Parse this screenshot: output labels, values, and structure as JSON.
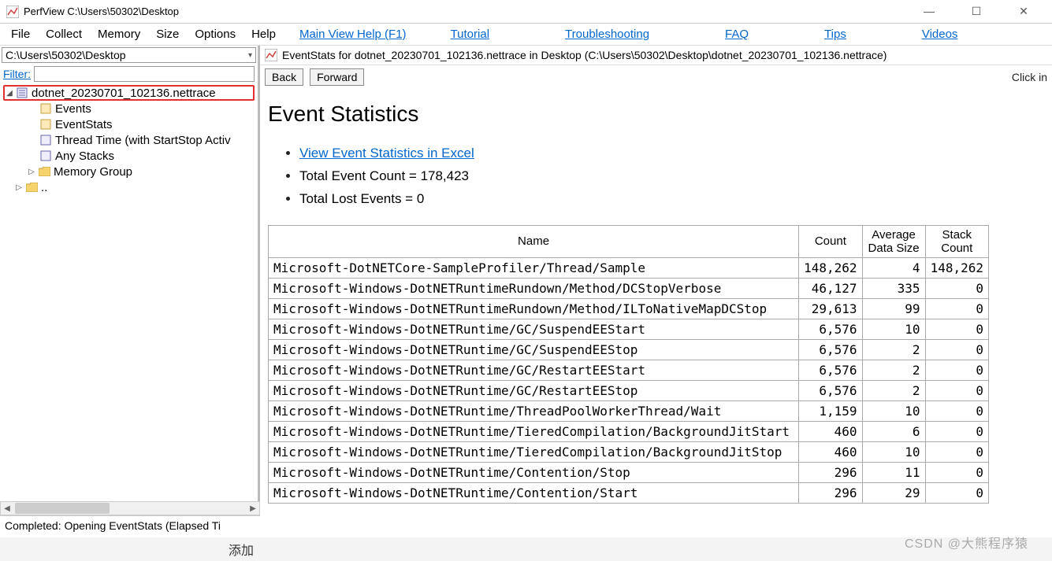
{
  "window": {
    "title": "PerfView C:\\Users\\50302\\Desktop",
    "min": "—",
    "max": "☐",
    "close": "✕"
  },
  "menu": {
    "file": "File",
    "collect": "Collect",
    "memory": "Memory",
    "size": "Size",
    "options": "Options",
    "help": "Help",
    "main_help": "Main View Help (F1)",
    "tutorial": "Tutorial",
    "troubleshooting": "Troubleshooting",
    "faq": "FAQ",
    "tips": "Tips",
    "videos": "Videos"
  },
  "left": {
    "path": "C:\\Users\\50302\\Desktop",
    "filter_label": "Filter:",
    "filter_value": "",
    "tree": {
      "root": "dotnet_20230701_102136.nettrace",
      "items": [
        "Events",
        "EventStats",
        "Thread Time (with StartStop Activ",
        "Any Stacks",
        "Memory Group"
      ],
      "dotdot": ".."
    },
    "status": "Completed: Opening EventStats  (Elapsed Ti"
  },
  "right": {
    "subtitle": "EventStats for dotnet_20230701_102136.nettrace in Desktop (C:\\Users\\50302\\Desktop\\dotnet_20230701_102136.nettrace)",
    "back": "Back",
    "forward": "Forward",
    "hint": "Click in",
    "heading": "Event Statistics",
    "link_excel": "View Event Statistics in Excel",
    "total_count": "Total Event Count = 178,423",
    "total_lost": "Total Lost Events = 0",
    "headers": {
      "name": "Name",
      "count": "Count",
      "avg": "Average Data Size",
      "stack": "Stack Count"
    },
    "rows": [
      {
        "name": "Microsoft-DotNETCore-SampleProfiler/Thread/Sample",
        "count": "148,262",
        "avg": "4",
        "stack": "148,262"
      },
      {
        "name": "Microsoft-Windows-DotNETRuntimeRundown/Method/DCStopVerbose",
        "count": "46,127",
        "avg": "335",
        "stack": "0"
      },
      {
        "name": "Microsoft-Windows-DotNETRuntimeRundown/Method/ILToNativeMapDCStop",
        "count": "29,613",
        "avg": "99",
        "stack": "0"
      },
      {
        "name": "Microsoft-Windows-DotNETRuntime/GC/SuspendEEStart",
        "count": "6,576",
        "avg": "10",
        "stack": "0"
      },
      {
        "name": "Microsoft-Windows-DotNETRuntime/GC/SuspendEEStop",
        "count": "6,576",
        "avg": "2",
        "stack": "0"
      },
      {
        "name": "Microsoft-Windows-DotNETRuntime/GC/RestartEEStart",
        "count": "6,576",
        "avg": "2",
        "stack": "0"
      },
      {
        "name": "Microsoft-Windows-DotNETRuntime/GC/RestartEEStop",
        "count": "6,576",
        "avg": "2",
        "stack": "0"
      },
      {
        "name": "Microsoft-Windows-DotNETRuntime/ThreadPoolWorkerThread/Wait",
        "count": "1,159",
        "avg": "10",
        "stack": "0"
      },
      {
        "name": "Microsoft-Windows-DotNETRuntime/TieredCompilation/BackgroundJitStart",
        "count": "460",
        "avg": "6",
        "stack": "0"
      },
      {
        "name": "Microsoft-Windows-DotNETRuntime/TieredCompilation/BackgroundJitStop",
        "count": "460",
        "avg": "10",
        "stack": "0"
      },
      {
        "name": "Microsoft-Windows-DotNETRuntime/Contention/Stop",
        "count": "296",
        "avg": "11",
        "stack": "0"
      },
      {
        "name": "Microsoft-Windows-DotNETRuntime/Contention/Start",
        "count": "296",
        "avg": "29",
        "stack": "0"
      }
    ]
  },
  "bottom": {
    "cn": "添加",
    "watermark": "CSDN @大熊程序猿"
  }
}
